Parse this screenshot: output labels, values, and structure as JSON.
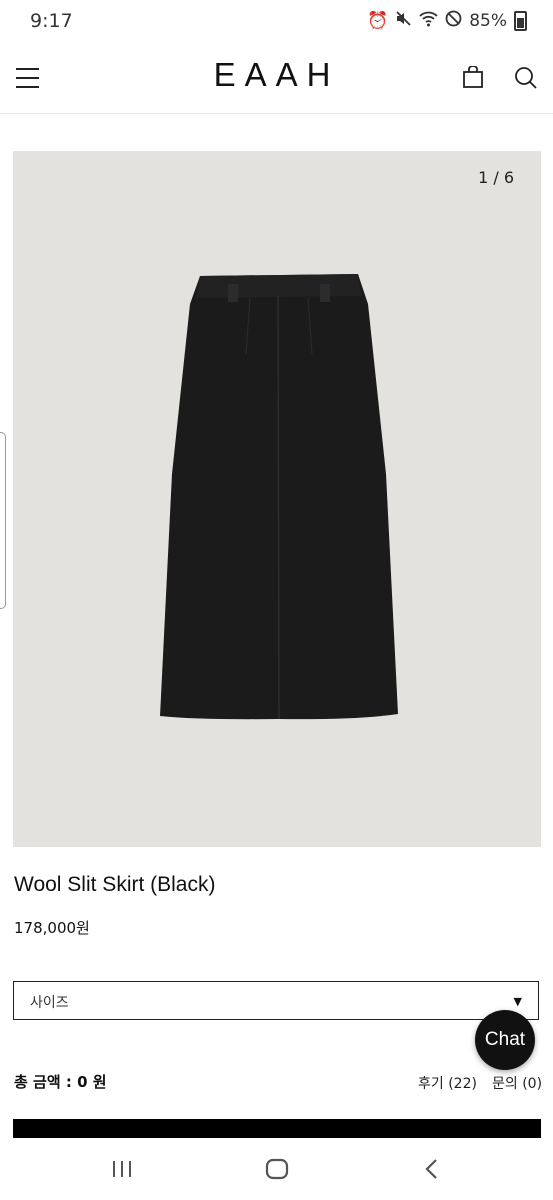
{
  "status": {
    "time": "9:17",
    "battery": "85%"
  },
  "header": {
    "logo": "EAAH"
  },
  "gallery": {
    "pager": "1 / 6"
  },
  "product": {
    "name": "Wool Slit Skirt (Black)",
    "price": "178,000원",
    "size_label": "사이즈",
    "total": "총 금액 : 0 원",
    "reviews": "후기 (22)",
    "qna": "문의 (0)"
  },
  "chat": {
    "label": "Chat"
  },
  "colors": {
    "image_bg": "#e4e2de",
    "skirt": "#1b1b1b",
    "accent": "#000000"
  },
  "icons": [
    "alarm-icon",
    "mute-icon",
    "wifi-icon",
    "dnd-icon",
    "battery-icon",
    "menu-icon",
    "bag-icon",
    "search-icon",
    "recent-apps-icon",
    "home-icon",
    "back-icon"
  ]
}
